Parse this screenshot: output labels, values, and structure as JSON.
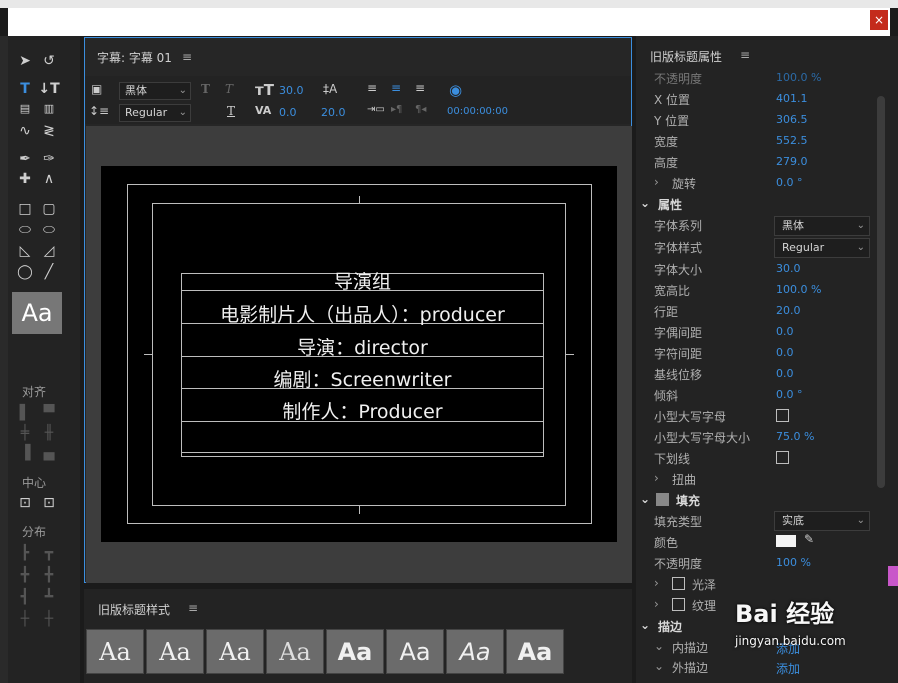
{
  "window": {
    "close_glyph": "×"
  },
  "toolbox": {
    "align_label": "对齐",
    "center_label": "中心",
    "distribute_label": "分布",
    "aa_label": "Aa"
  },
  "title_panel": {
    "header": "字幕: 字幕 01",
    "font_family": "黑体",
    "font_style": "Regular",
    "font_size": "30.0",
    "kerning": "0.0",
    "leading": "20.0",
    "timecode": "00:00:00:00",
    "lines": [
      "导演组",
      "电影制片人（出品人）：producer",
      "导演：director",
      "编剧：Screenwriter",
      "制作人：Producer"
    ]
  },
  "styles_panel": {
    "header": "旧版标题样式",
    "swatches": [
      "Aa",
      "Aa",
      "Aa",
      "Aa",
      "Aa",
      "Aa",
      "Aa",
      "Aa"
    ]
  },
  "properties": {
    "header": "旧版标题属性",
    "top_row_label": "不透明度",
    "top_row_value": "100.0 %",
    "x_label": "X 位置",
    "x_value": "401.1",
    "y_label": "Y 位置",
    "y_value": "306.5",
    "width_label": "宽度",
    "width_value": "552.5",
    "height_label": "高度",
    "height_value": "279.0",
    "rotation_label": "旋转",
    "rotation_value": "0.0 °",
    "props_section": "属性",
    "font_family_label": "字体系列",
    "font_family_value": "黑体",
    "font_style_label": "字体样式",
    "font_style_value": "Regular",
    "font_size_label": "字体大小",
    "font_size_value": "30.0",
    "aspect_label": "宽高比",
    "aspect_value": "100.0 %",
    "leading_label": "行距",
    "leading_value": "20.0",
    "kerning_label": "字偶间距",
    "kerning_value": "0.0",
    "tracking_label": "字符间距",
    "tracking_value": "0.0",
    "baseline_label": "基线位移",
    "baseline_value": "0.0",
    "slant_label": "倾斜",
    "slant_value": "0.0 °",
    "smallcaps_label": "小型大写字母",
    "smallcaps_size_label": "小型大写字母大小",
    "smallcaps_size_value": "75.0 %",
    "underline_label": "下划线",
    "distort_label": "扭曲",
    "fill_section": "填充",
    "fill_type_label": "填充类型",
    "fill_type_value": "实底",
    "color_label": "颜色",
    "opacity_label": "不透明度",
    "opacity_value": "100 %",
    "sheen_label": "光泽",
    "texture_label": "纹理",
    "stroke_section": "描边",
    "inner_stroke_label": "内描边",
    "inner_stroke_value": "添加",
    "outer_stroke_label": "外描边",
    "outer_stroke_value": "添加"
  },
  "watermark": {
    "brand": "Bai 经验",
    "url": "jingyan.baidu.com"
  }
}
